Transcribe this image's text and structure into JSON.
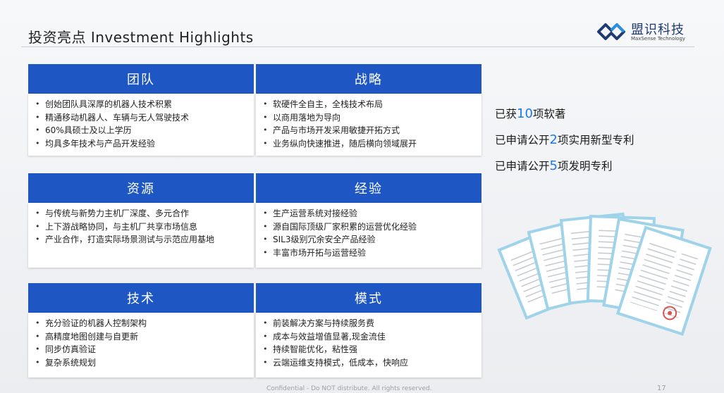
{
  "header": {
    "title": "投资亮点  Investment Highlights",
    "logo": {
      "name": "盟识科技",
      "subtitle": "MaxSense Technology"
    }
  },
  "cards": [
    {
      "title": "团队",
      "items": [
        "创始团队具深厚的机器人技术积累",
        "精通移动机器人、车辆与无人驾驶技术",
        "60%具硕士及以上学历",
        "均具多年技术与产品开发经验"
      ]
    },
    {
      "title": "战略",
      "items": [
        "软硬件全自主，全栈技术布局",
        "以商用落地为导向",
        "产品与市场开发采用敏捷开拓方式",
        "业务纵向快速推进，随后横向领域展开"
      ]
    },
    {
      "title": "资源",
      "items": [
        "与传统与新势力主机厂深度、多元合作",
        "上下游战略协同，与主机厂共享市场信息",
        "产业合作，打造实际场景测试与示范应用基地"
      ]
    },
    {
      "title": "经验",
      "items": [
        "生产运营系统对接经验",
        "源自国际顶级厂家积累的运营优化经验",
        "SIL3级别冗余安全产品经验",
        "丰富市场开拓与运营经验"
      ]
    },
    {
      "title": "技术",
      "items": [
        "充分验证的机器人控制架构",
        "高精度地图创建与自更新",
        "同步仿真验证",
        "复杂系统规划"
      ]
    },
    {
      "title": "模式",
      "items": [
        "前装解决方案与持续服务费",
        "成本与效益增值显著,现金流佳",
        "持续智能优化，粘性强",
        "云端运维支持模式，低成本，快响应"
      ]
    }
  ],
  "stats": [
    {
      "prefix": "已获",
      "num": "10",
      "suffix": "项软著"
    },
    {
      "prefix": "已申请公开",
      "num": "2",
      "suffix": "项实用新型专利"
    },
    {
      "prefix": "已申请公开",
      "num": "5",
      "suffix": "项发明专利"
    }
  ],
  "footer": {
    "confidential": "Confidential - Do NOT distribute. All rights reserved.",
    "page": "17"
  },
  "colors": {
    "accent": "#1e57c4",
    "number": "#1e78e6"
  }
}
